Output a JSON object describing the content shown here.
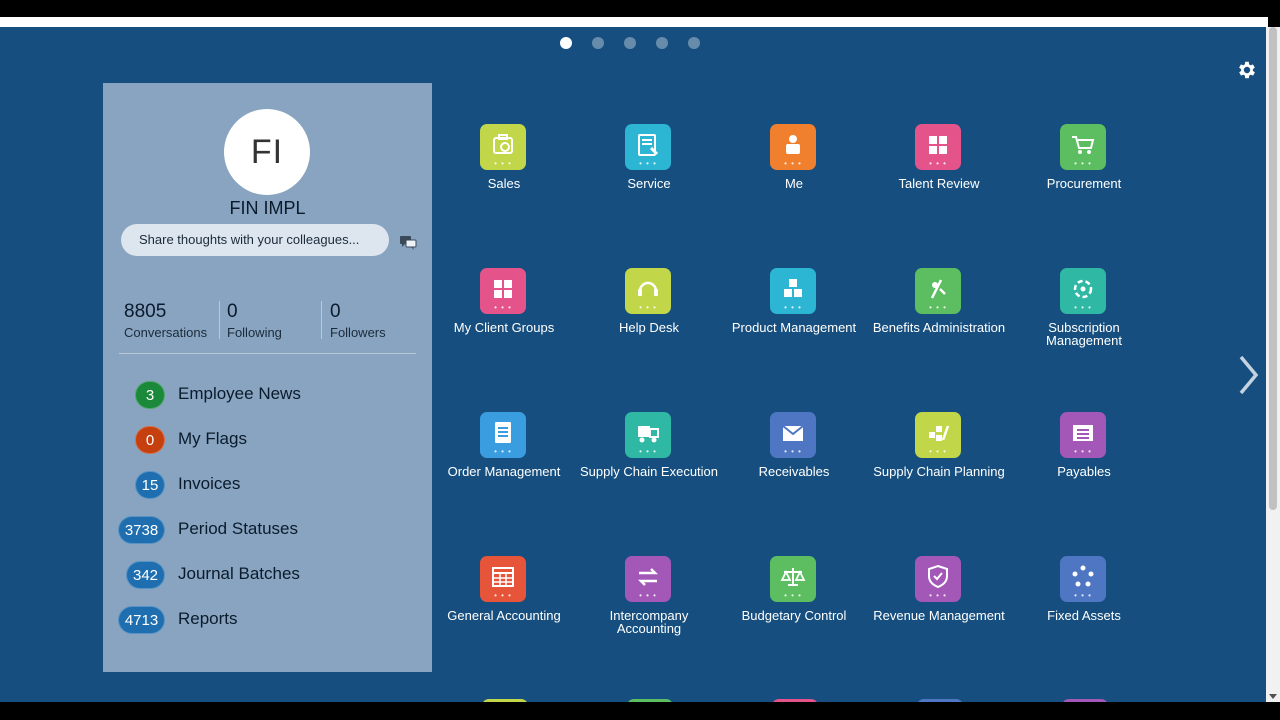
{
  "pager": {
    "active_index": 0,
    "count": 5
  },
  "profile": {
    "initials": "FI",
    "name": "FIN IMPL",
    "share_placeholder": "Share thoughts with your colleagues...",
    "stats": [
      {
        "value": "8805",
        "label": "Conversations"
      },
      {
        "value": "0",
        "label": "Following"
      },
      {
        "value": "0",
        "label": "Followers"
      }
    ],
    "links": [
      {
        "count": "3",
        "label": "Employee News",
        "color": "#1a8a3a"
      },
      {
        "count": "0",
        "label": "My Flags",
        "color": "#c5400e"
      },
      {
        "count": "15",
        "label": "Invoices",
        "color": "#1f6fb0"
      },
      {
        "count": "3738",
        "label": "Period Statuses",
        "color": "#1f6fb0"
      },
      {
        "count": "342",
        "label": "Journal Batches",
        "color": "#1f6fb0"
      },
      {
        "count": "4713",
        "label": "Reports",
        "color": "#1f6fb0"
      }
    ]
  },
  "tiles": [
    {
      "label": "Sales",
      "color": "#c1d648",
      "icon": "sales-icon"
    },
    {
      "label": "Service",
      "color": "#2cb6d3",
      "icon": "service-icon"
    },
    {
      "label": "Me",
      "color": "#f07f2e",
      "icon": "me-icon"
    },
    {
      "label": "Talent Review",
      "color": "#e4548a",
      "icon": "talent-review-icon"
    },
    {
      "label": "Procurement",
      "color": "#5dbd61",
      "icon": "procurement-icon"
    },
    {
      "label": "My Client Groups",
      "color": "#e4548a",
      "icon": "client-groups-icon"
    },
    {
      "label": "Help Desk",
      "color": "#c1d648",
      "icon": "help-desk-icon"
    },
    {
      "label": "Product Management",
      "color": "#2cb6d3",
      "icon": "product-management-icon"
    },
    {
      "label": "Benefits Administration",
      "color": "#5dbd61",
      "icon": "benefits-icon"
    },
    {
      "label": "Subscription Management",
      "color": "#2fb8a4",
      "icon": "subscription-icon"
    },
    {
      "label": "Order Management",
      "color": "#3a9de0",
      "icon": "order-management-icon"
    },
    {
      "label": "Supply Chain Execution",
      "color": "#2fb8a4",
      "icon": "supply-chain-execution-icon"
    },
    {
      "label": "Receivables",
      "color": "#4f76c2",
      "icon": "receivables-icon"
    },
    {
      "label": "Supply Chain Planning",
      "color": "#c1d648",
      "icon": "supply-chain-planning-icon"
    },
    {
      "label": "Payables",
      "color": "#a358b8",
      "icon": "payables-icon"
    },
    {
      "label": "General Accounting",
      "color": "#e6543a",
      "icon": "general-accounting-icon"
    },
    {
      "label": "Intercompany Accounting",
      "color": "#a358b8",
      "icon": "intercompany-icon"
    },
    {
      "label": "Budgetary Control",
      "color": "#5dbd61",
      "icon": "budgetary-control-icon"
    },
    {
      "label": "Revenue Management",
      "color": "#a358b8",
      "icon": "revenue-management-icon"
    },
    {
      "label": "Fixed Assets",
      "color": "#4f76c2",
      "icon": "fixed-assets-icon"
    }
  ],
  "partial_tiles": [
    "#c1d648",
    "#5dbd61",
    "#e4548a",
    "#4f76c2",
    "#a358b8"
  ]
}
